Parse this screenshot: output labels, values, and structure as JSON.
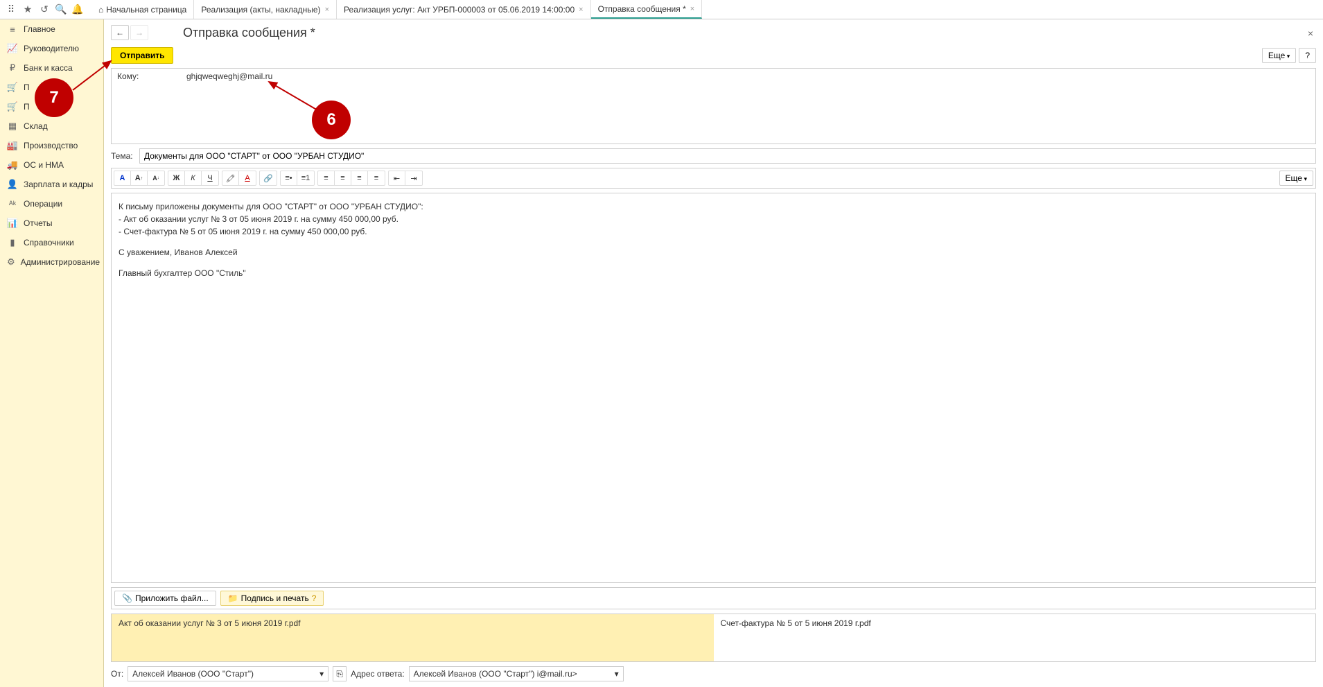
{
  "tabs": [
    {
      "label": "Начальная страница",
      "closable": false
    },
    {
      "label": "Реализация (акты, накладные)",
      "closable": true
    },
    {
      "label": "Реализация услуг: Акт УРБП-000003 от 05.06.2019 14:00:00",
      "closable": true
    },
    {
      "label": "Отправка сообщения *",
      "closable": true,
      "active": true
    }
  ],
  "sidebar": [
    {
      "icon": "menu",
      "label": "Главное"
    },
    {
      "icon": "chart-up",
      "label": "Руководителю"
    },
    {
      "icon": "coin",
      "label": "Банк и касса"
    },
    {
      "icon": "cart",
      "label": "П"
    },
    {
      "icon": "cart",
      "label": "П"
    },
    {
      "icon": "grid",
      "label": "Склад"
    },
    {
      "icon": "factory",
      "label": "Производство"
    },
    {
      "icon": "truck",
      "label": "ОС и НМА"
    },
    {
      "icon": "person",
      "label": "Зарплата и кадры"
    },
    {
      "icon": "ops",
      "label": "Операции"
    },
    {
      "icon": "bars",
      "label": "Отчеты"
    },
    {
      "icon": "book",
      "label": "Справочники"
    },
    {
      "icon": "gear",
      "label": "Администрирование"
    }
  ],
  "page": {
    "title": "Отправка сообщения *",
    "sendLabel": "Отправить",
    "moreLabel": "Еще",
    "helpLabel": "?",
    "toLabel": "Кому:",
    "toValue": "ghjqweqweghj@mail.ru",
    "subjectLabel": "Тема:",
    "subjectValue": "Документы для ООО \"СТАРТ\" от ООО \"УРБАН СТУДИО\"",
    "body": {
      "line1": "К письму приложены документы для ООО \"СТАРТ\" от ООО \"УРБАН СТУДИО\":",
      "line2": "- Акт об оказании услуг № 3 от 05 июня 2019 г. на сумму 450 000,00 руб.",
      "line3": "- Счет-фактура № 5 от 05 июня 2019 г. на сумму 450 000,00 руб.",
      "line4": "С уважением, Иванов Алексей",
      "line5": "Главный бухгалтер ООО \"Стиль\""
    },
    "attachLabel": "Приложить файл...",
    "signLabel": "Подпись и печать",
    "attachments": [
      "Акт об оказании услуг № 3 от 5 июня 2019 г.pdf",
      "Счет-фактура № 5 от 5 июня 2019 г.pdf"
    ],
    "fromLabel": "От:",
    "fromValue": "Алексей Иванов (ООО \"Старт\")",
    "replyLabel": "Адрес ответа:",
    "replyValue": "Алексей Иванов (ООО \"Старт\")          і@mail.ru>"
  },
  "callouts": {
    "c6": "6",
    "c7": "7"
  }
}
